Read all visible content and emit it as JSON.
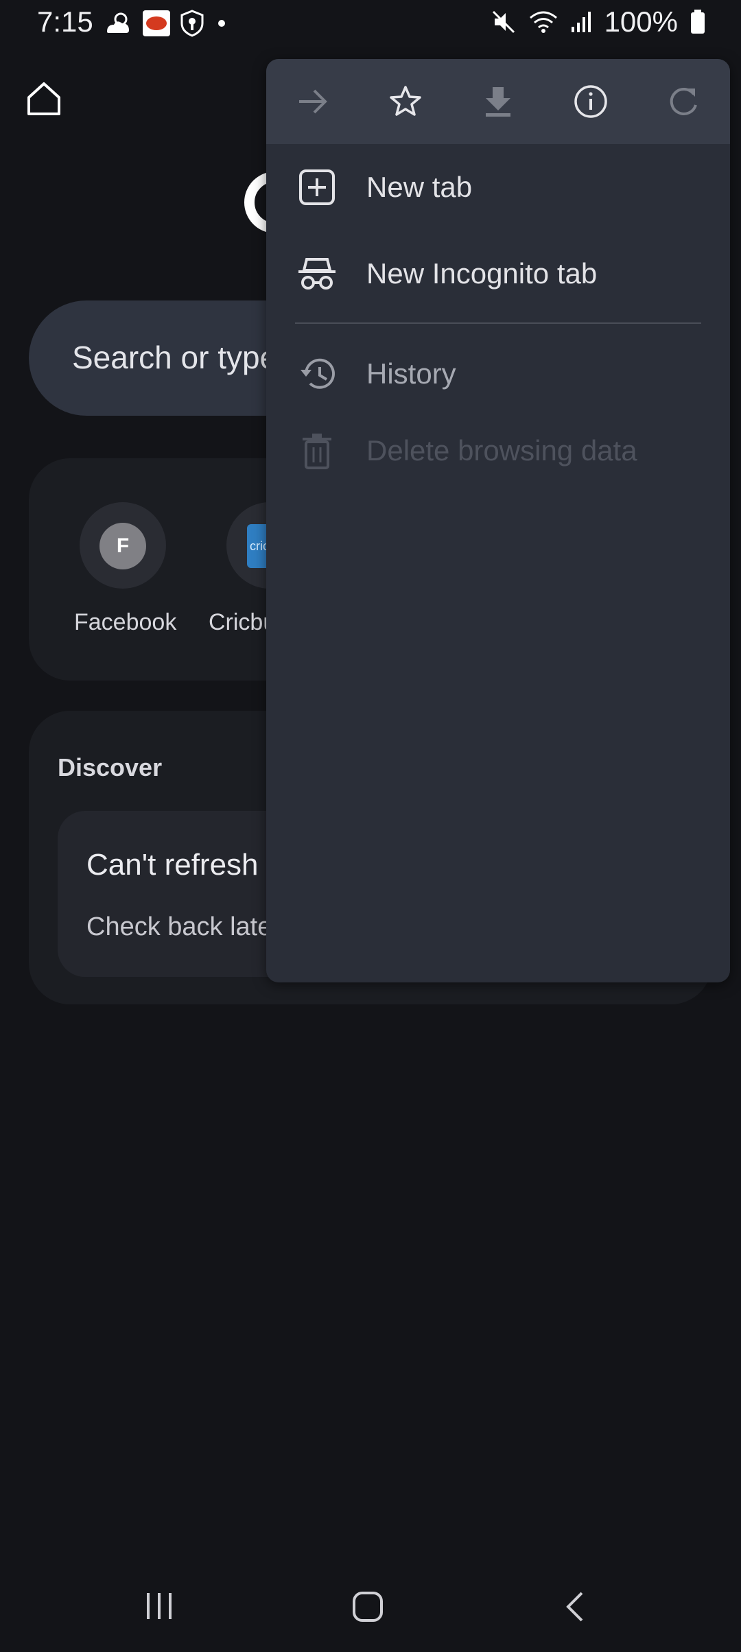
{
  "status_bar": {
    "time": "7:15",
    "battery": "100%",
    "icons": [
      "weather-icon",
      "app-icon",
      "shield-icon",
      "dot",
      "mute-icon",
      "wifi-icon",
      "signal-icon",
      "battery-icon"
    ]
  },
  "search": {
    "placeholder": "Search or type"
  },
  "shortcuts": [
    {
      "letter": "F",
      "label": "Facebook"
    },
    {
      "letter": "cric",
      "label": "Cricbu"
    }
  ],
  "discover": {
    "title": "Discover",
    "card_title": "Can't refresh",
    "card_subtitle": "Check back late"
  },
  "menu": {
    "toolbar": [
      "forward-icon",
      "bookmark-star-icon",
      "download-icon",
      "info-icon",
      "refresh-icon"
    ],
    "items": [
      {
        "label": "New tab",
        "enabled": true
      },
      {
        "label": "New Incognito tab",
        "enabled": true
      },
      {
        "label": "History",
        "enabled": true
      },
      {
        "label": "Delete browsing data",
        "enabled": false
      }
    ]
  },
  "colors": {
    "background": "#131418",
    "menu": "#2a2e38",
    "menu_toolbar": "#373c48",
    "search_bar": "#2f3440"
  }
}
